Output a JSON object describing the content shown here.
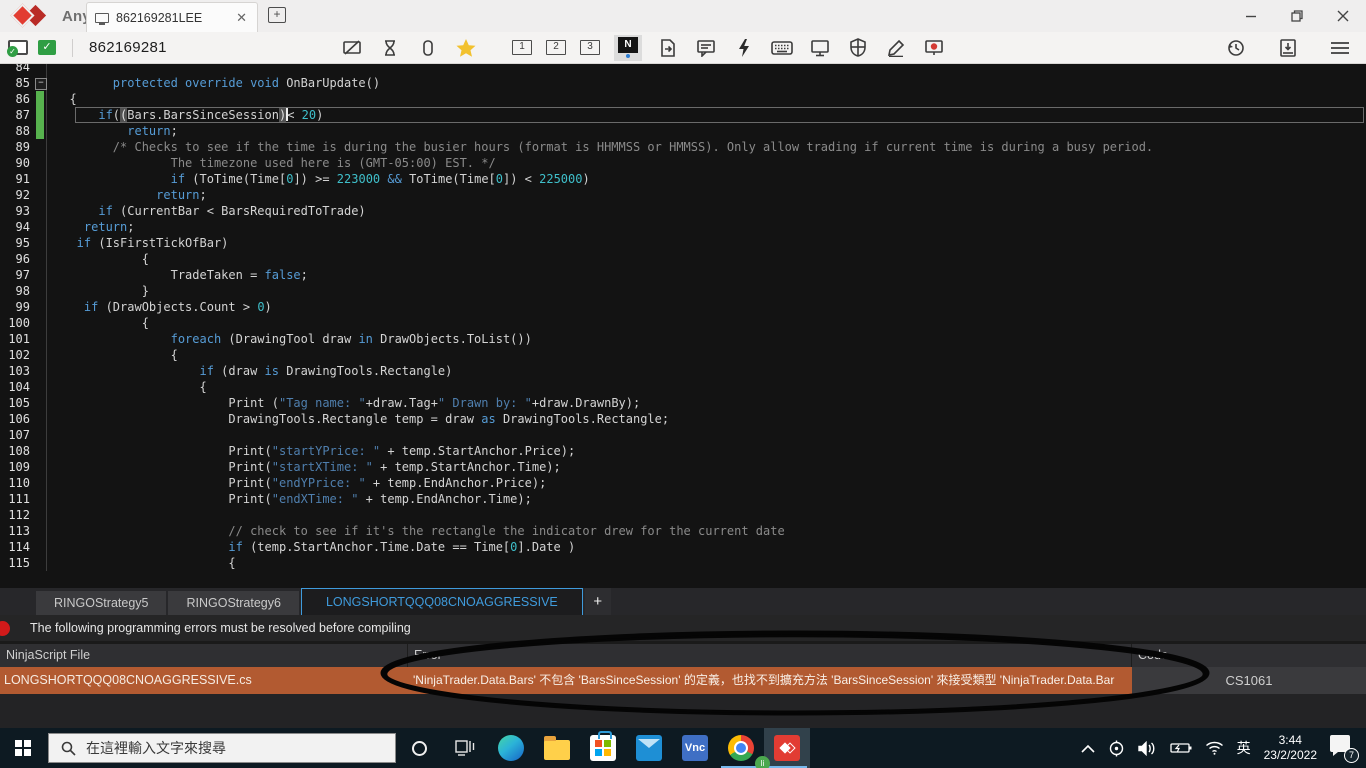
{
  "titlebar": {
    "brand": "AnyDesk",
    "session_tab": "862169281LEE",
    "close_glyph": "✕"
  },
  "toolbar": {
    "address": "862169281",
    "monitors": [
      "1",
      "2",
      "3"
    ],
    "n_label": "N"
  },
  "editor": {
    "lines": [
      {
        "n": 84,
        "seg": []
      },
      {
        "n": 85,
        "fold": true,
        "seg": [
          [
            "k",
            "        protected override void "
          ],
          [
            "p",
            "OnBarUpdate()"
          ]
        ]
      },
      {
        "n": 86,
        "chg": true,
        "seg": [
          [
            "p",
            "  {"
          ]
        ]
      },
      {
        "n": 87,
        "chg": true,
        "cur": true,
        "seg": [
          [
            "k",
            "      if"
          ],
          [
            "p",
            "("
          ],
          [
            "hl",
            "("
          ],
          [
            "p",
            "Bars.BarsSinceSession"
          ],
          [
            "hl",
            ")"
          ],
          [
            "caret",
            ""
          ],
          [
            "p",
            "< "
          ],
          [
            "n",
            "20"
          ],
          [
            "p",
            ")"
          ]
        ]
      },
      {
        "n": 88,
        "chg": true,
        "seg": [
          [
            "k",
            "          return"
          ],
          [
            "p",
            ";"
          ]
        ]
      },
      {
        "n": 89,
        "seg": [
          [
            "c",
            "        /* Checks to see if the time is during the busier hours (format is HHMMSS or HMMSS). Only allow trading if current time is during a busy period."
          ]
        ]
      },
      {
        "n": 90,
        "seg": [
          [
            "c",
            "                The timezone used here is (GMT-05:00) EST. */"
          ]
        ]
      },
      {
        "n": 91,
        "seg": [
          [
            "k",
            "                if"
          ],
          [
            "p",
            " (ToTime(Time["
          ],
          [
            "n",
            "0"
          ],
          [
            "p",
            "]) >= "
          ],
          [
            "n",
            "223000"
          ],
          [
            "p",
            " "
          ],
          [
            "k",
            "&&"
          ],
          [
            "p",
            " ToTime(Time["
          ],
          [
            "n",
            "0"
          ],
          [
            "p",
            "]) < "
          ],
          [
            "n",
            "225000"
          ],
          [
            "p",
            ")"
          ]
        ]
      },
      {
        "n": 92,
        "seg": [
          [
            "k",
            "              return"
          ],
          [
            "p",
            ";"
          ]
        ]
      },
      {
        "n": 93,
        "seg": [
          [
            "k",
            "      if"
          ],
          [
            "p",
            " (CurrentBar < BarsRequiredToTrade)"
          ]
        ]
      },
      {
        "n": 94,
        "seg": [
          [
            "k",
            "    return"
          ],
          [
            "p",
            ";"
          ]
        ]
      },
      {
        "n": 95,
        "seg": [
          [
            "k",
            "   if"
          ],
          [
            "p",
            " (IsFirstTickOfBar)"
          ]
        ]
      },
      {
        "n": 96,
        "seg": [
          [
            "p",
            "            {"
          ]
        ]
      },
      {
        "n": 97,
        "seg": [
          [
            "p",
            "                TradeTaken = "
          ],
          [
            "k",
            "false"
          ],
          [
            "p",
            ";"
          ]
        ]
      },
      {
        "n": 98,
        "seg": [
          [
            "p",
            "            }"
          ]
        ]
      },
      {
        "n": 99,
        "seg": [
          [
            "k",
            "    if"
          ],
          [
            "p",
            " (DrawObjects.Count > "
          ],
          [
            "n",
            "0"
          ],
          [
            "p",
            ")"
          ]
        ]
      },
      {
        "n": 100,
        "seg": [
          [
            "p",
            "            {"
          ]
        ]
      },
      {
        "n": 101,
        "seg": [
          [
            "k",
            "                foreach"
          ],
          [
            "p",
            " (DrawingTool draw "
          ],
          [
            "k",
            "in"
          ],
          [
            "p",
            " DrawObjects.ToList())"
          ]
        ]
      },
      {
        "n": 102,
        "seg": [
          [
            "p",
            "                {"
          ]
        ]
      },
      {
        "n": 103,
        "seg": [
          [
            "k",
            "                    if"
          ],
          [
            "p",
            " (draw "
          ],
          [
            "k",
            "is"
          ],
          [
            "p",
            " DrawingTools.Rectangle)"
          ]
        ]
      },
      {
        "n": 104,
        "seg": [
          [
            "p",
            "                    {"
          ]
        ]
      },
      {
        "n": 105,
        "seg": [
          [
            "p",
            "                        Print ("
          ],
          [
            "s",
            "\"Tag name: \""
          ],
          [
            "p",
            "+draw.Tag+"
          ],
          [
            "s",
            "\" Drawn by: \""
          ],
          [
            "p",
            "+draw.DrawnBy);"
          ]
        ]
      },
      {
        "n": 106,
        "seg": [
          [
            "p",
            "                        DrawingTools.Rectangle temp = draw "
          ],
          [
            "k",
            "as"
          ],
          [
            "p",
            " DrawingTools.Rectangle;"
          ]
        ]
      },
      {
        "n": 107,
        "seg": []
      },
      {
        "n": 108,
        "seg": [
          [
            "p",
            "                        Print("
          ],
          [
            "s",
            "\"startYPrice: \""
          ],
          [
            "p",
            " + temp.StartAnchor.Price);"
          ]
        ]
      },
      {
        "n": 109,
        "seg": [
          [
            "p",
            "                        Print("
          ],
          [
            "s",
            "\"startXTime: \""
          ],
          [
            "p",
            " + temp.StartAnchor.Time);"
          ]
        ]
      },
      {
        "n": 110,
        "seg": [
          [
            "p",
            "                        Print("
          ],
          [
            "s",
            "\"endYPrice: \""
          ],
          [
            "p",
            " + temp.EndAnchor.Price);"
          ]
        ]
      },
      {
        "n": 111,
        "seg": [
          [
            "p",
            "                        Print("
          ],
          [
            "s",
            "\"endXTime: \""
          ],
          [
            "p",
            " + temp.EndAnchor.Time);"
          ]
        ]
      },
      {
        "n": 112,
        "seg": []
      },
      {
        "n": 113,
        "seg": [
          [
            "c",
            "                        // check to see if it's the rectangle the indicator drew for the current date"
          ]
        ]
      },
      {
        "n": 114,
        "seg": [
          [
            "k",
            "                        if"
          ],
          [
            "p",
            " (temp.StartAnchor.Time.Date == Time["
          ],
          [
            "n",
            "0"
          ],
          [
            "p",
            "].Date )"
          ]
        ]
      },
      {
        "n": 115,
        "seg": [
          [
            "p",
            "                        {"
          ]
        ]
      }
    ]
  },
  "script_tabs": {
    "tabs": [
      "RINGOStrategy5",
      "RINGOStrategy6",
      "LONGSHORTQQQ08CNOAGGRESSIVE"
    ],
    "active_index": 2,
    "add_label": "+"
  },
  "error_panel": {
    "message": "The following programming errors must be resolved before compiling",
    "columns": [
      "NinjaScript File",
      "Error",
      "Code"
    ],
    "rows": [
      {
        "file": "LONGSHORTQQQ08CNOAGGRESSIVE.cs",
        "error": "'NinjaTrader.Data.Bars' 不包含 'BarsSinceSession' 的定義，也找不到擴充方法 'BarsSinceSession' 來接受類型 'NinjaTrader.Data.Bar",
        "code": "CS1061"
      }
    ]
  },
  "taskbar": {
    "search_placeholder": "在這裡輸入文字來搜尋",
    "vnc_label": "Vnc",
    "chrome_badge": "li"
  },
  "tray": {
    "language": "英",
    "time": "3:44",
    "date": "23/2/2022",
    "notification_count": "7"
  },
  "colors": {
    "anydesk_red": "#e23c33",
    "editor_bg": "#131313",
    "keyword_blue": "#569cd6",
    "number_teal": "#3fbfca",
    "string_blue": "#4f7fae",
    "comment_gray": "#8a8a8a",
    "change_bar_green": "#57b24e",
    "active_tab_blue": "#3f9bdc",
    "error_row_orange": "#b25a31",
    "taskbar_bg": "#0d1a22"
  }
}
